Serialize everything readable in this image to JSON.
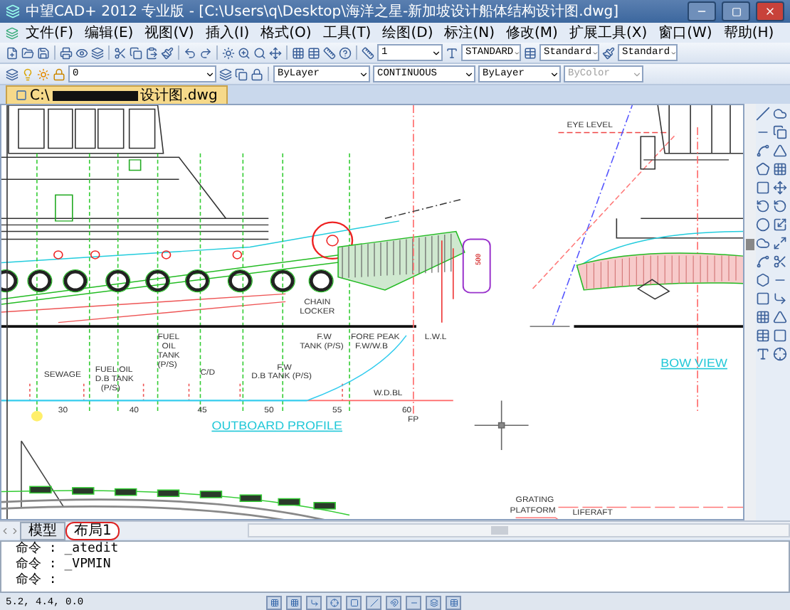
{
  "window": {
    "title": "中望CAD+ 2012 专业版 - [C:\\Users\\q\\Desktop\\海洋之星-新加坡设计船体结构设计图.dwg]"
  },
  "menu": [
    {
      "label": "文件(F)"
    },
    {
      "label": "编辑(E)"
    },
    {
      "label": "视图(V)"
    },
    {
      "label": "插入(I)"
    },
    {
      "label": "格式(O)"
    },
    {
      "label": "工具(T)"
    },
    {
      "label": "绘图(D)"
    },
    {
      "label": "标注(N)"
    },
    {
      "label": "修改(M)"
    },
    {
      "label": "扩展工具(X)"
    },
    {
      "label": "窗口(W)"
    },
    {
      "label": "帮助(H)"
    }
  ],
  "toolbar_top": {
    "combos": [
      {
        "value": "1"
      },
      {
        "value": "STANDARD"
      },
      {
        "value": "Standard"
      },
      {
        "value": "Standard"
      }
    ]
  },
  "toolbar_properties": {
    "layer": "0",
    "combos": [
      {
        "value": "ByLayer",
        "disabled": false
      },
      {
        "value": "CONTINUOUS",
        "disabled": false
      },
      {
        "value": "ByLayer",
        "disabled": false
      },
      {
        "value": "ByColor",
        "disabled": true
      }
    ]
  },
  "document_tab": {
    "path_start": "C:\\",
    "path_end": "设计图.dwg"
  },
  "drawing": {
    "labels": [
      {
        "text": "EYE LEVEL",
        "kind": "note"
      },
      {
        "text": "CHAIN",
        "kind": "note"
      },
      {
        "text": "LOCKER",
        "kind": "note"
      },
      {
        "text": "500",
        "kind": "dimension"
      },
      {
        "text": "FUEL",
        "kind": "note"
      },
      {
        "text": "OIL",
        "kind": "note"
      },
      {
        "text": "TANK",
        "kind": "note"
      },
      {
        "text": "(P/S)",
        "kind": "note"
      },
      {
        "text": "F.W",
        "kind": "note"
      },
      {
        "text": "TANK (P/S)",
        "kind": "note"
      },
      {
        "text": "FORE PEAK",
        "kind": "note"
      },
      {
        "text": "F.W/W.B",
        "kind": "note"
      },
      {
        "text": "L.W.L",
        "kind": "note"
      },
      {
        "text": "SEWAGE",
        "kind": "note"
      },
      {
        "text": "FUEL OIL",
        "kind": "note"
      },
      {
        "text": "D.B TANK",
        "kind": "note"
      },
      {
        "text": "(P/S)",
        "kind": "note"
      },
      {
        "text": "C/D",
        "kind": "note"
      },
      {
        "text": "F.W",
        "kind": "note"
      },
      {
        "text": "D.B TANK (P/S)",
        "kind": "note"
      },
      {
        "text": "W.D.BL",
        "kind": "note"
      },
      {
        "text": "30",
        "kind": "frame"
      },
      {
        "text": "40",
        "kind": "frame"
      },
      {
        "text": "45",
        "kind": "frame"
      },
      {
        "text": "50",
        "kind": "frame"
      },
      {
        "text": "55",
        "kind": "frame"
      },
      {
        "text": "60",
        "kind": "frame"
      },
      {
        "text": "FP",
        "kind": "note"
      },
      {
        "text": "OUTBOARD PROFILE",
        "kind": "title"
      },
      {
        "text": "BOW VIEW",
        "kind": "title"
      },
      {
        "text": "GRATING",
        "kind": "note"
      },
      {
        "text": "PLATFORM",
        "kind": "note"
      },
      {
        "text": "LIFERAFT",
        "kind": "note"
      }
    ]
  },
  "layout_tabs": [
    {
      "label": "模型",
      "selected": false
    },
    {
      "label": "布局1",
      "selected": true
    }
  ],
  "command_history": [
    "命令 : _atedit",
    "命令 : _VPMIN"
  ],
  "command_prompt": "命令 :",
  "status_bar": {
    "coordinates": "5.2, 4.4, 0.0"
  }
}
